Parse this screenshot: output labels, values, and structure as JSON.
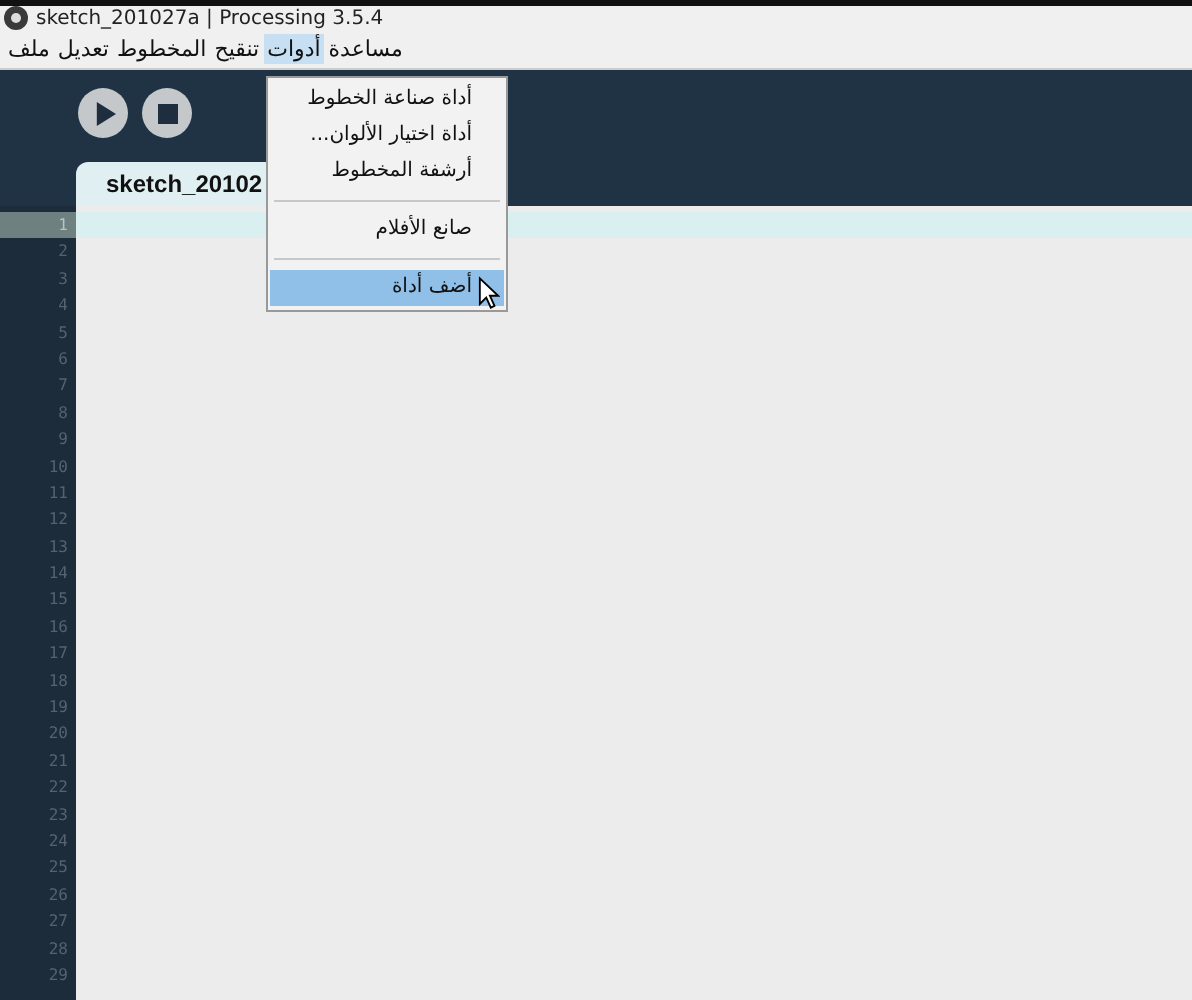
{
  "window": {
    "title": "sketch_201027a | Processing 3.5.4"
  },
  "menu_bar": [
    {
      "label": "مساعدة",
      "selected": false
    },
    {
      "label": "أدوات",
      "selected": true
    },
    {
      "label": "تنقيح",
      "selected": false
    },
    {
      "label": "المخطوط",
      "selected": false
    },
    {
      "label": "تعديل",
      "selected": false
    },
    {
      "label": "ملف",
      "selected": false
    }
  ],
  "dropdown": {
    "items": [
      {
        "kind": "item",
        "label": "أداة صناعة الخطوط",
        "selected": false
      },
      {
        "kind": "item",
        "label": "أداة اختيار الألوان...",
        "selected": false
      },
      {
        "kind": "item",
        "label": "أرشفة المخطوط",
        "selected": false
      },
      {
        "kind": "separator"
      },
      {
        "kind": "item",
        "label": "صانع الأفلام",
        "selected": false
      },
      {
        "kind": "separator"
      },
      {
        "kind": "item",
        "label": "أضف أداة",
        "selected": true
      }
    ]
  },
  "toolbar": {
    "buttons": [
      {
        "kind": "run"
      },
      {
        "kind": "stop"
      }
    ]
  },
  "tabs": [
    {
      "label": "sketch_20102",
      "selected": true
    }
  ],
  "editor": {
    "lines": [
      {
        "number": "1",
        "selected": true
      },
      {
        "number": "2",
        "selected": false
      },
      {
        "number": "3",
        "selected": false
      },
      {
        "number": "4",
        "selected": false
      },
      {
        "number": "5",
        "selected": false
      },
      {
        "number": "6",
        "selected": false
      },
      {
        "number": "7",
        "selected": false
      },
      {
        "number": "8",
        "selected": false
      },
      {
        "number": "9",
        "selected": false
      },
      {
        "number": "10",
        "selected": false
      },
      {
        "number": "11",
        "selected": false
      },
      {
        "number": "12",
        "selected": false
      },
      {
        "number": "13",
        "selected": false
      },
      {
        "number": "14",
        "selected": false
      },
      {
        "number": "15",
        "selected": false
      },
      {
        "number": "16",
        "selected": false
      },
      {
        "number": "17",
        "selected": false
      },
      {
        "number": "18",
        "selected": false
      },
      {
        "number": "19",
        "selected": false
      },
      {
        "number": "20",
        "selected": false
      },
      {
        "number": "21",
        "selected": false
      },
      {
        "number": "22",
        "selected": false
      },
      {
        "number": "23",
        "selected": false
      },
      {
        "number": "24",
        "selected": false
      },
      {
        "number": "25",
        "selected": false
      },
      {
        "number": "26",
        "selected": false
      },
      {
        "number": "27",
        "selected": false
      },
      {
        "number": "28",
        "selected": false
      },
      {
        "number": "29",
        "selected": false
      }
    ]
  }
}
